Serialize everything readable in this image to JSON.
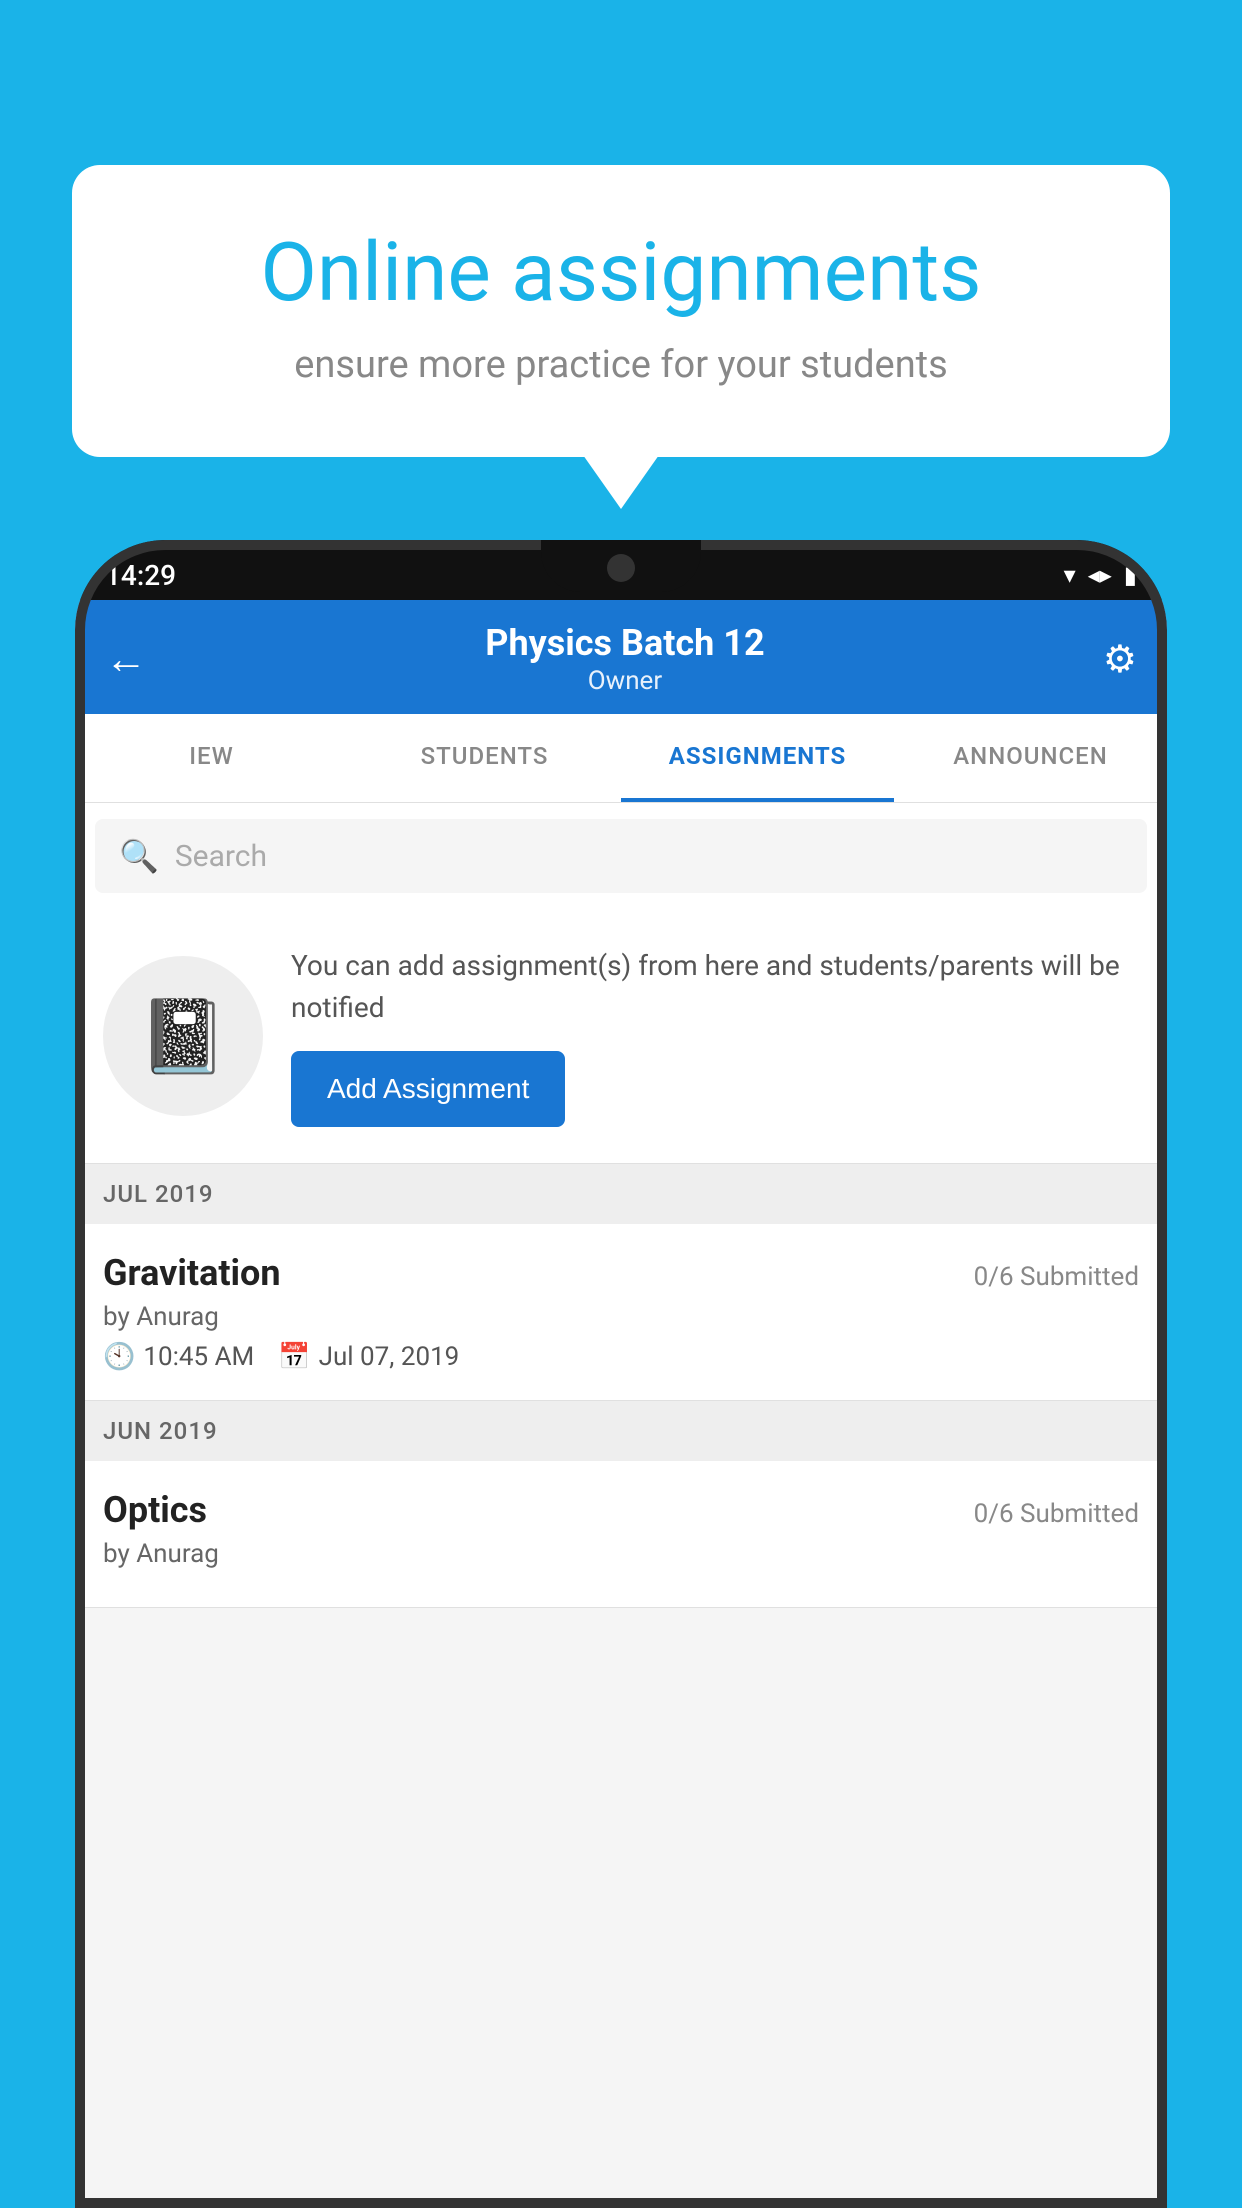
{
  "background": {
    "color": "#1ab3e8"
  },
  "speech_bubble": {
    "title": "Online assignments",
    "subtitle": "ensure more practice for your students"
  },
  "status_bar": {
    "time": "14:29",
    "wifi": "▾",
    "signal": "▲",
    "battery": "▮"
  },
  "header": {
    "title": "Physics Batch 12",
    "subtitle": "Owner",
    "back_icon": "←",
    "settings_icon": "⚙"
  },
  "tabs": [
    {
      "label": "IEW",
      "active": false
    },
    {
      "label": "STUDENTS",
      "active": false
    },
    {
      "label": "ASSIGNMENTS",
      "active": true
    },
    {
      "label": "ANNOUNCEN",
      "active": false
    }
  ],
  "search": {
    "placeholder": "Search"
  },
  "promo": {
    "description": "You can add assignment(s) from here and students/parents will be notified",
    "button_label": "Add Assignment"
  },
  "sections": [
    {
      "month": "JUL 2019",
      "assignments": [
        {
          "name": "Gravitation",
          "submitted": "0/6 Submitted",
          "by": "by Anurag",
          "time": "10:45 AM",
          "date": "Jul 07, 2019"
        }
      ]
    },
    {
      "month": "JUN 2019",
      "assignments": [
        {
          "name": "Optics",
          "submitted": "0/6 Submitted",
          "by": "by Anurag",
          "time": "",
          "date": ""
        }
      ]
    }
  ]
}
